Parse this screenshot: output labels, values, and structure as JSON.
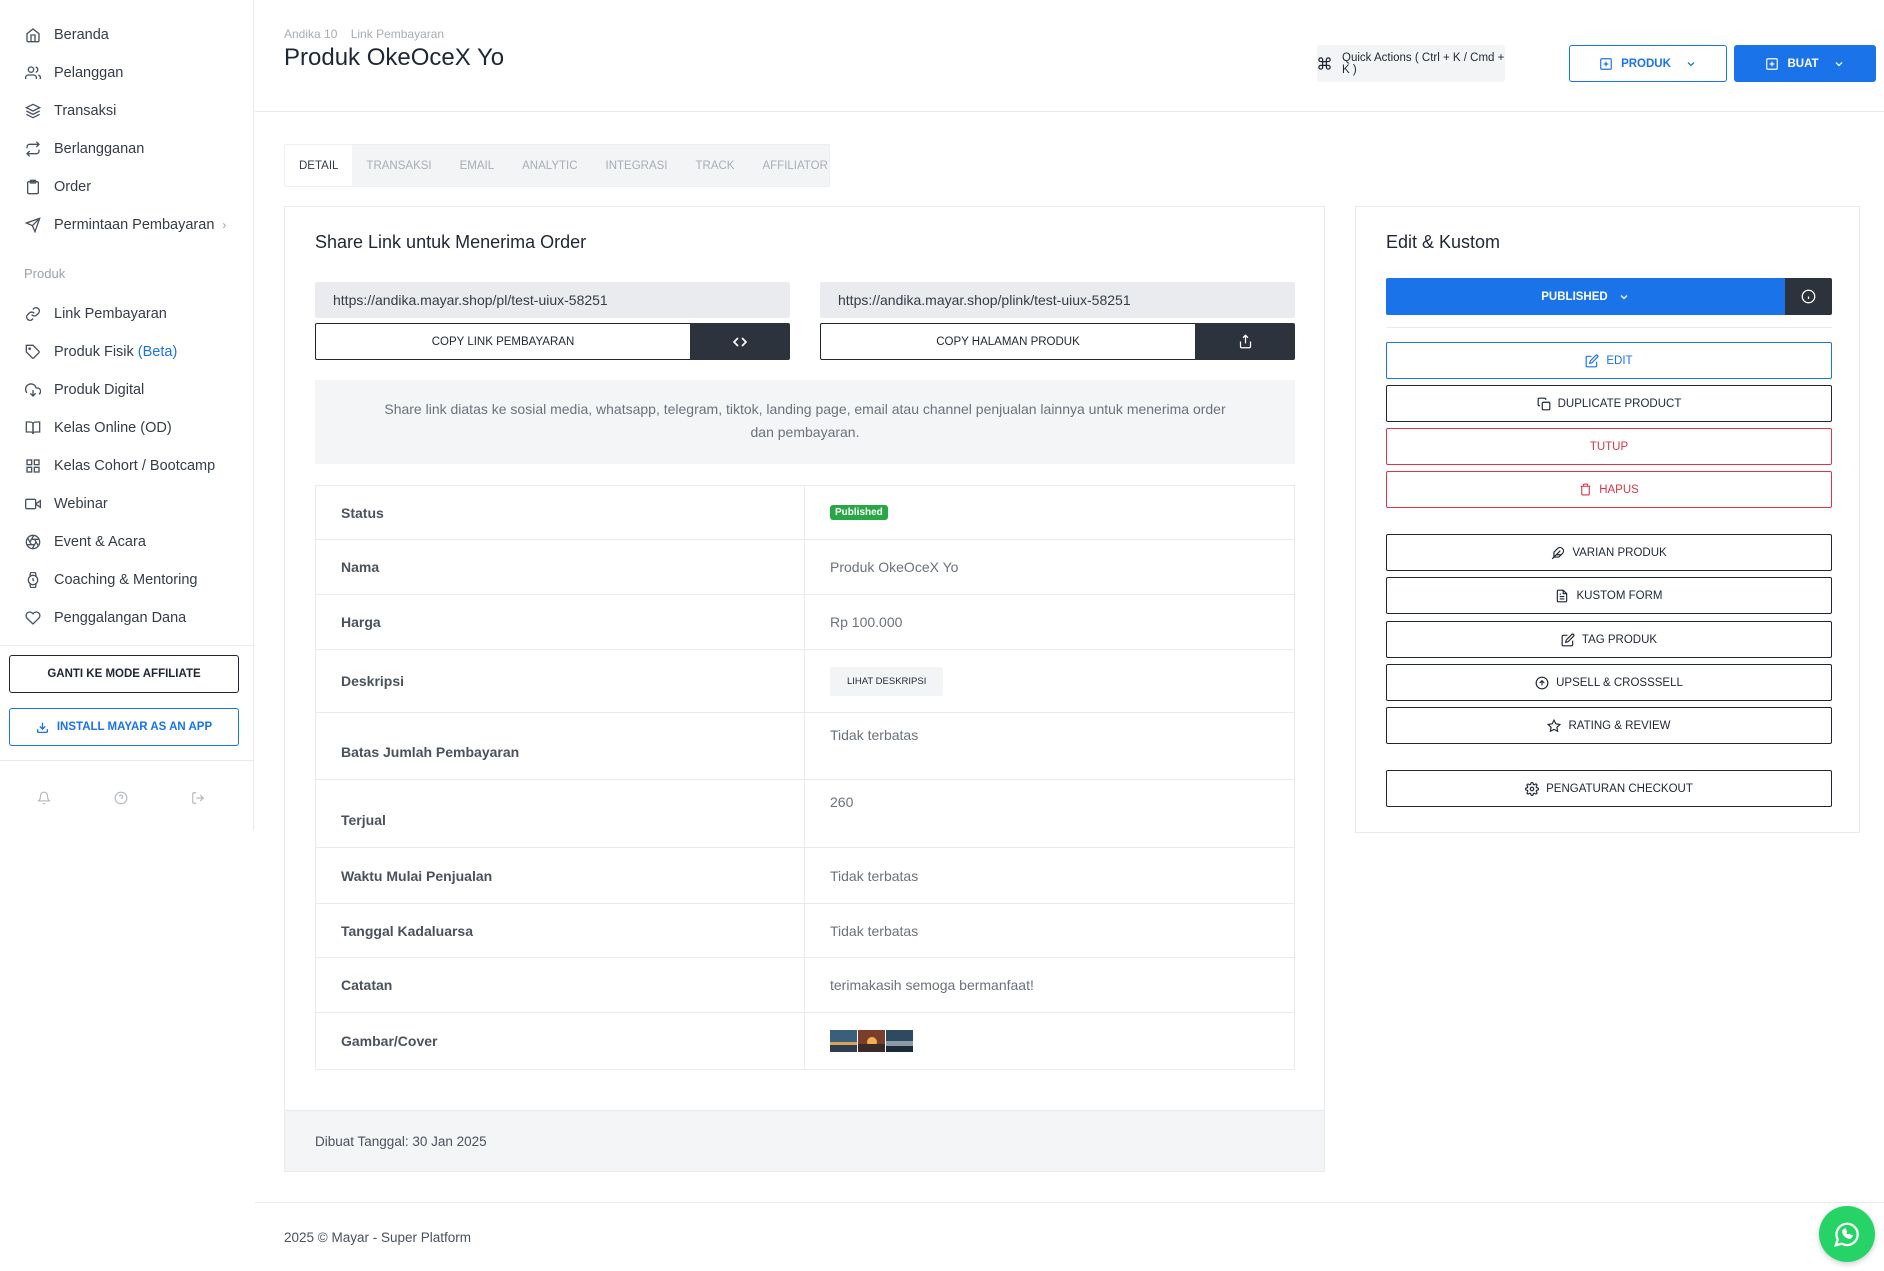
{
  "sidebar": {
    "items": [
      {
        "label": "Beranda",
        "icon": "home-icon"
      },
      {
        "label": "Pelanggan",
        "icon": "users-icon"
      },
      {
        "label": "Transaksi",
        "icon": "layers-icon"
      },
      {
        "label": "Berlangganan",
        "icon": "repeat-icon"
      },
      {
        "label": "Order",
        "icon": "clipboard-icon"
      },
      {
        "label": "Permintaan Pembayaran",
        "icon": "send-icon"
      }
    ],
    "section_label": "Produk",
    "product_items": [
      {
        "label": "Link Pembayaran",
        "icon": "link-icon"
      },
      {
        "label": "Produk Fisik",
        "badge": "(Beta)",
        "icon": "tag-icon"
      },
      {
        "label": "Produk Digital",
        "icon": "cloud-download-icon"
      },
      {
        "label": "Kelas Online (OD)",
        "icon": "book-open-icon"
      },
      {
        "label": "Kelas Cohort / Bootcamp",
        "icon": "grid-icon"
      },
      {
        "label": "Webinar",
        "icon": "video-icon"
      },
      {
        "label": "Event & Acara",
        "icon": "aperture-icon"
      },
      {
        "label": "Coaching & Mentoring",
        "icon": "watch-icon"
      },
      {
        "label": "Penggalangan Dana",
        "icon": "heart-icon"
      }
    ],
    "affiliate_button": "GANTI KE MODE AFFILIATE",
    "install_button": "INSTALL MAYAR AS AN APP"
  },
  "header": {
    "breadcrumb": [
      "Andika 10",
      "Link Pembayaran"
    ],
    "title": "Produk OkeOceX Yo",
    "quick_actions": "Quick Actions ( Ctrl + K / Cmd + K )",
    "produk_button": "PRODUK",
    "buat_button": "BUAT"
  },
  "tabs": [
    "DETAIL",
    "TRANSAKSI",
    "EMAIL",
    "ANALYTIC",
    "INTEGRASI",
    "TRACK",
    "AFFILIATOR"
  ],
  "share": {
    "title": "Share Link untuk Menerima Order",
    "link_payment": "https://andika.mayar.shop/pl/test-uiux-58251",
    "link_product": "https://andika.mayar.shop/plink/test-uiux-58251",
    "copy_payment": "COPY LINK PEMBAYARAN",
    "copy_product": "COPY HALAMAN PRODUK",
    "info": "Share link diatas ke sosial media, whatsapp, telegram, tiktok, landing page, email atau channel penjualan lainnya untuk menerima order dan pembayaran."
  },
  "details": {
    "status_label": "Status",
    "status_value": "Published",
    "nama_label": "Nama",
    "nama_value": "Produk OkeOceX Yo",
    "harga_label": "Harga",
    "harga_value": "Rp 100.000",
    "deskripsi_label": "Deskripsi",
    "deskripsi_button": "LIHAT DESKRIPSI",
    "batas_label": "Batas Jumlah Pembayaran",
    "batas_value": "Tidak terbatas",
    "terjual_label": "Terjual",
    "terjual_value": "260",
    "mulai_label": "Waktu Mulai Penjualan",
    "mulai_value": "Tidak terbatas",
    "kadaluarsa_label": "Tanggal Kadaluarsa",
    "kadaluarsa_value": "Tidak terbatas",
    "catatan_label": "Catatan",
    "catatan_value": "terimakasih semoga bermanfaat!",
    "gambar_label": "Gambar/Cover"
  },
  "created": "Dibuat Tanggal: 30 Jan 2025",
  "edit": {
    "title": "Edit & Kustom",
    "published": "PUBLISHED",
    "edit": "EDIT",
    "duplicate": "DUPLICATE PRODUCT",
    "tutup": "TUTUP",
    "hapus": "HAPUS",
    "varian": "VARIAN PRODUK",
    "kustom_form": "KUSTOM FORM",
    "tag": "TAG PRODUK",
    "upsell": "UPSELL & CROSSSELL",
    "rating": "RATING & REVIEW",
    "checkout": "PENGATURAN CHECKOUT"
  },
  "footer": "2025 © Mayar - Super Platform",
  "colors": {
    "primary": "#1a73e8",
    "danger": "#dc3545",
    "success": "#28a745",
    "dark": "#2d333c"
  }
}
